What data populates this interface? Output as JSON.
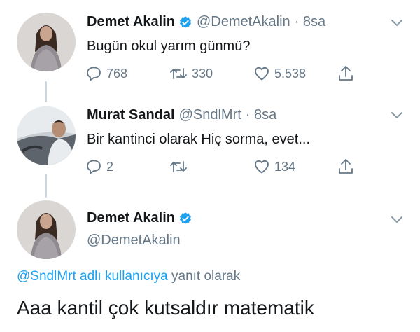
{
  "colors": {
    "verified": "#1da1f2",
    "link": "#1da1f2",
    "muted": "#657786",
    "text": "#14171a",
    "thread_line": "#ccd6dd"
  },
  "tweet1": {
    "name": "Demet Akalin",
    "handle": "@DemetAkalin",
    "time": "· 8sa",
    "text": "Bugün okul yarım günmü?",
    "replies": "768",
    "retweets": "330",
    "likes": "5.538"
  },
  "tweet2": {
    "name": "Murat Sandal",
    "handle": "@SndlMrt",
    "time": "· 8sa",
    "text": "Bir kantinci olarak Hiç sorma, evet...",
    "replies": "2",
    "retweets": "",
    "likes": "134"
  },
  "tweet3": {
    "name": "Demet Akalin",
    "handle": "@DemetAkalin",
    "reply_to_link": "@SndlMrt adlı kullanıcıya",
    "reply_to_suffix": "yanıt olarak",
    "text": "Aaa kantil çok kutsaldır matematik"
  }
}
